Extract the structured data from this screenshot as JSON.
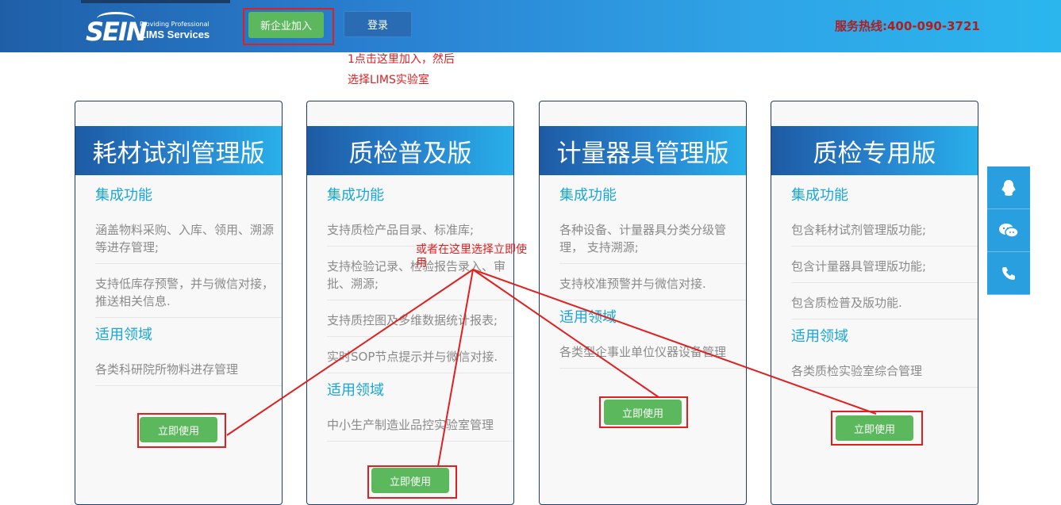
{
  "header": {
    "logo_text": "SEIN",
    "logo_tagline": "Providing Professional",
    "logo_service": "LIMS Services",
    "join_label": "新企业加入",
    "login_label": "登录",
    "hotline": "服务热线:400-090-3721"
  },
  "annotations": {
    "note1_line1": "1点击这里加入，然后",
    "note1_line2": "选择LIMS实验室",
    "note2_line1": "或者在这里选择立即使",
    "note2_line2": "用"
  },
  "cards": [
    {
      "title": "耗材试剂管理版",
      "features_heading": "集成功能",
      "features": [
        "涵盖物料采购、入库、领用、溯源等进存管理;",
        "支持低库存预警，并与微信对接，推送相关信息."
      ],
      "domain_heading": "适用领域",
      "domains": [
        "各类科研院所物料进存管理"
      ],
      "button": "立即使用"
    },
    {
      "title": "质检普及版",
      "features_heading": "集成功能",
      "features": [
        "支持质检产品目录、标准库;",
        "支持检验记录、检验报告录入、审批、溯源;",
        "支持质控图及多维数据统计报表;",
        "实时SOP节点提示并与微信对接."
      ],
      "domain_heading": "适用领域",
      "domains": [
        "中小生产制造业品控实验室管理"
      ],
      "button": "立即使用"
    },
    {
      "title": "计量器具管理版",
      "features_heading": "集成功能",
      "features": [
        "各种设备、计量器具分类分级管理， 支持溯源;",
        "支持校准预警并与微信对接."
      ],
      "domain_heading": "适用领域",
      "domains": [
        "各类型企事业单位仪器设备管理"
      ],
      "button": "立即使用"
    },
    {
      "title": "质检专用版",
      "features_heading": "集成功能",
      "features": [
        "包含耗材试剂管理版功能;",
        "包含计量器具管理版功能;",
        "包含质检普及版功能."
      ],
      "domain_heading": "适用领域",
      "domains": [
        "各类质检实验室综合管理"
      ],
      "button": "立即使用"
    }
  ],
  "sidebar": {
    "icons": [
      "qq-icon",
      "wechat-icon",
      "phone-icon"
    ]
  }
}
